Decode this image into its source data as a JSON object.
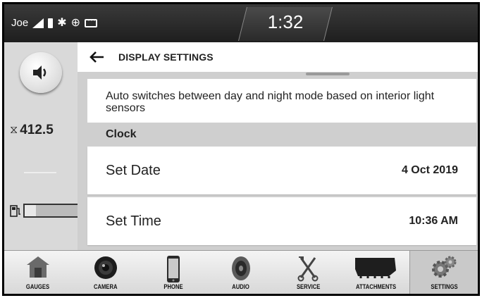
{
  "status_bar": {
    "user_name": "Joe",
    "clock": "1:32",
    "icons": [
      "signal-icon",
      "battery-icon",
      "bluetooth-icon",
      "gps-icon",
      "message-icon"
    ]
  },
  "rail": {
    "volume_icon": "speaker-icon",
    "hour_meter": "412.5",
    "fuel_level_fraction": 0.2
  },
  "header": {
    "title": "DISPLAY SETTINGS"
  },
  "content": {
    "description": "Auto switches between day and night mode based on interior light sensors",
    "section_label": "Clock",
    "rows": [
      {
        "label": "Set Date",
        "value": "4 Oct 2019"
      },
      {
        "label": "Set Time",
        "value": "10:36 AM"
      }
    ]
  },
  "nav": {
    "active": "SETTINGS",
    "items": [
      {
        "label": "GAUGES",
        "icon": "house-icon"
      },
      {
        "label": "CAMERA",
        "icon": "camera-icon"
      },
      {
        "label": "PHONE",
        "icon": "phone-icon"
      },
      {
        "label": "AUDIO",
        "icon": "speaker-icon"
      },
      {
        "label": "SERVICE",
        "icon": "wrench-icon"
      },
      {
        "label": "ATTACHMENTS",
        "icon": "bucket-icon"
      },
      {
        "label": "SETTINGS",
        "icon": "gear-icon"
      }
    ]
  }
}
